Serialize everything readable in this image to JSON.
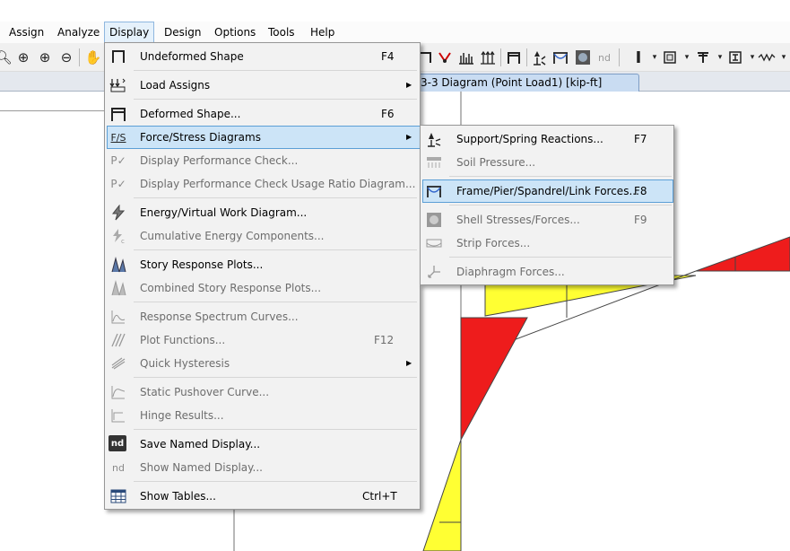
{
  "menubar": {
    "items": [
      {
        "label": "Assign"
      },
      {
        "label": "Analyze"
      },
      {
        "label": "Display"
      },
      {
        "label": "Design"
      },
      {
        "label": "Options"
      },
      {
        "label": "Tools"
      },
      {
        "label": "Help"
      }
    ]
  },
  "toolbar": {
    "nd_label": "nd"
  },
  "document_tab": {
    "title": "3-3 Diagram   (Point Load1)  [kip-ft]"
  },
  "display_menu": {
    "items": [
      {
        "label": "Undeformed Shape",
        "shortcut": "F4",
        "enabled": true,
        "icon": "undeformed-shape-icon"
      },
      {
        "label": "Load Assigns",
        "shortcut": "",
        "enabled": true,
        "submenu": true,
        "icon": "load-assigns-icon"
      },
      {
        "label": "Deformed Shape...",
        "shortcut": "F6",
        "enabled": true,
        "icon": "deformed-shape-icon"
      },
      {
        "label": "Force/Stress Diagrams",
        "shortcut": "",
        "enabled": true,
        "submenu": true,
        "highlighted": true,
        "icon": "force-stress-icon",
        "icon_text": "F/S"
      },
      {
        "label": "Display Performance Check...",
        "shortcut": "",
        "enabled": false,
        "icon": "performance-check-icon"
      },
      {
        "label": "Display Performance Check Usage Ratio Diagram...",
        "shortcut": "",
        "enabled": false,
        "icon": "usage-ratio-icon"
      },
      {
        "label": "Energy/Virtual Work Diagram...",
        "shortcut": "",
        "enabled": true,
        "icon": "energy-icon"
      },
      {
        "label": "Cumulative Energy Components...",
        "shortcut": "",
        "enabled": false,
        "icon": "cumulative-energy-icon"
      },
      {
        "label": "Story Response Plots...",
        "shortcut": "",
        "enabled": true,
        "icon": "story-response-icon"
      },
      {
        "label": "Combined Story Response Plots...",
        "shortcut": "",
        "enabled": false,
        "icon": "combined-story-icon"
      },
      {
        "label": "Response Spectrum Curves...",
        "shortcut": "",
        "enabled": false,
        "icon": "response-spectrum-icon"
      },
      {
        "label": "Plot Functions...",
        "shortcut": "F12",
        "enabled": false,
        "icon": "plot-functions-icon"
      },
      {
        "label": "Quick Hysteresis",
        "shortcut": "",
        "enabled": false,
        "submenu": true,
        "icon": "hysteresis-icon"
      },
      {
        "label": "Static Pushover Curve...",
        "shortcut": "",
        "enabled": false,
        "icon": "pushover-icon"
      },
      {
        "label": "Hinge Results...",
        "shortcut": "",
        "enabled": false,
        "icon": "hinge-icon"
      },
      {
        "label": "Save Named Display...",
        "shortcut": "",
        "enabled": true,
        "icon": "save-named-display-icon",
        "icon_text": "nd"
      },
      {
        "label": "Show Named Display...",
        "shortcut": "",
        "enabled": false,
        "icon": "show-named-display-icon",
        "icon_text": "nd"
      },
      {
        "label": "Show Tables...",
        "shortcut": "Ctrl+T",
        "enabled": true,
        "icon": "tables-icon"
      }
    ]
  },
  "force_submenu": {
    "items": [
      {
        "label": "Support/Spring Reactions...",
        "shortcut": "F7",
        "enabled": true,
        "icon": "support-reactions-icon"
      },
      {
        "label": "Soil Pressure...",
        "shortcut": "",
        "enabled": false,
        "icon": "soil-pressure-icon"
      },
      {
        "label": "Frame/Pier/Spandrel/Link Forces...",
        "shortcut": "F8",
        "enabled": true,
        "highlighted": true,
        "icon": "frame-forces-icon"
      },
      {
        "label": "Shell Stresses/Forces...",
        "shortcut": "F9",
        "enabled": false,
        "icon": "shell-stresses-icon"
      },
      {
        "label": "Strip Forces...",
        "shortcut": "",
        "enabled": false,
        "icon": "strip-forces-icon"
      },
      {
        "label": "Diaphragm Forces...",
        "shortcut": "",
        "enabled": false,
        "icon": "diaphragm-forces-icon"
      }
    ]
  },
  "colors": {
    "diagram_red": "#ee1c1c",
    "diagram_yellow": "#ffff33",
    "highlight": "#cce4f7",
    "highlight_border": "#5c9fd6"
  }
}
